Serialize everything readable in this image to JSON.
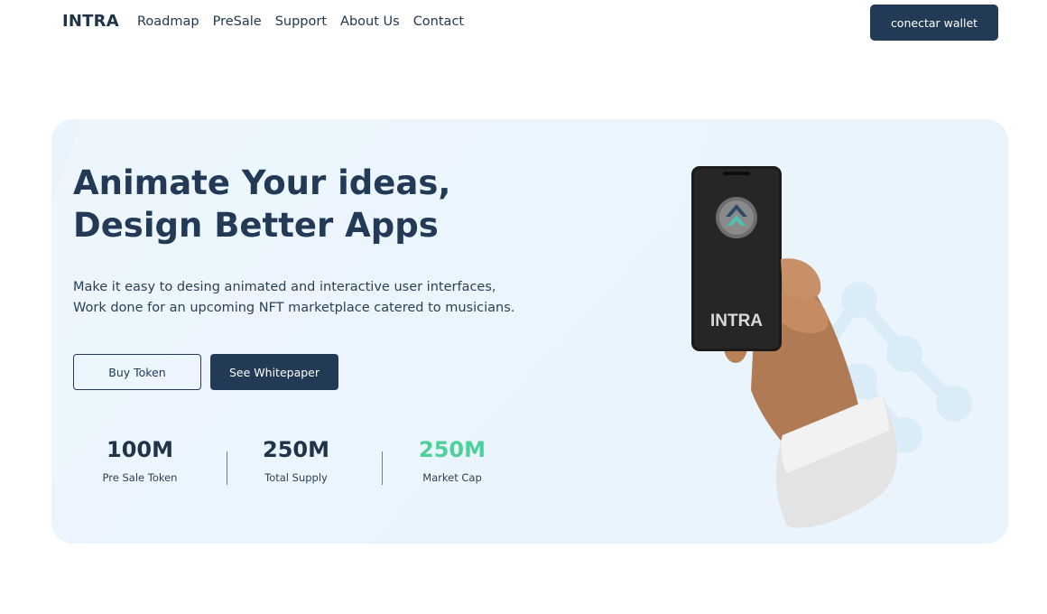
{
  "nav": {
    "brand": "INTRA",
    "links": [
      "Roadmap",
      "PreSale",
      "Support",
      "About Us",
      "Contact"
    ],
    "wallet_button": "conectar wallet"
  },
  "hero": {
    "headline_line1": "Animate Your ideas,",
    "headline_line2": "Design Better Apps",
    "description_line1": "Make it easy to desing animated and interactive user interfaces,",
    "description_line2": "Work done for an upcoming NFT marketplace catered to musicians.",
    "buy_button": "Buy Token",
    "whitepaper_button": "See Whitepaper",
    "stats": [
      {
        "value": "100M",
        "label": "Pre Sale Token"
      },
      {
        "value": "250M",
        "label": "Total Supply"
      },
      {
        "value": "250M",
        "label": "Market Cap"
      }
    ],
    "phone_label": "INTRA"
  },
  "colors": {
    "primary": "#223a55",
    "hero_bg": "#e9f4fd",
    "accent_green": "#4fcf9a"
  }
}
